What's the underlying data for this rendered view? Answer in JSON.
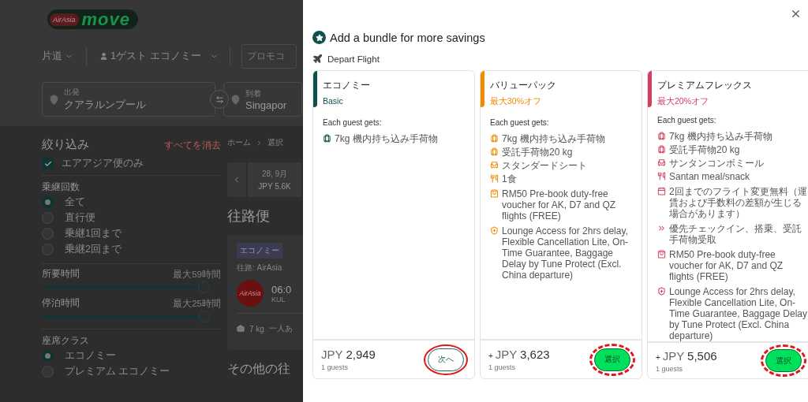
{
  "background_page": {
    "logo": {
      "badge": "AirAsia",
      "wordmark": "move"
    },
    "search_bar": {
      "trip_type": "片道",
      "guests": "1ゲスト エコノミー",
      "promo_placeholder": "プロモコ"
    },
    "origin": {
      "label": "出発",
      "value": "クアラルンプール"
    },
    "destination": {
      "label": "到着",
      "value": "Singapor"
    },
    "filters": {
      "title": "絞り込み",
      "clear": "すべてを消去",
      "airasia_only": {
        "label": "エアアジア便のみ",
        "checked": true
      },
      "stops": {
        "title": "乗継回数",
        "options": [
          {
            "label": "全て",
            "selected": true
          },
          {
            "label": "直行便",
            "selected": false
          },
          {
            "label": "乗継1回まで",
            "selected": false
          },
          {
            "label": "乗継2回まで",
            "selected": false
          }
        ]
      },
      "sliders": [
        {
          "title": "所要時間",
          "reading": "最大59時間",
          "level": 1
        },
        {
          "title": "停泊時間",
          "reading": "最大25時間",
          "level": 1
        }
      ],
      "cabin": {
        "title": "座席クラス",
        "options": [
          {
            "label": "エコノミー",
            "selected": true
          },
          {
            "label": "プレミアム エコノミー",
            "selected": false
          }
        ]
      }
    },
    "breadcrumb": [
      "ホーム",
      "選択"
    ],
    "date_strip": {
      "date": "28, 9月",
      "price": "JPY 5.6K"
    },
    "section_title": "往路便",
    "flight_card": {
      "tag": "エコノミー",
      "route": "往路: AirAsia",
      "airline_logo": "AirAsia",
      "time": "06:0",
      "airport": "KUL",
      "baggage": "7 kg",
      "note": "一人あ"
    },
    "more_title": "その他の往"
  },
  "drawer": {
    "title": "Add a bundle for more savings",
    "flight_label": "Depart Flight",
    "bundles": [
      {
        "name": "エコノミー",
        "subtitle": "Basic",
        "color": "#0f4f4f",
        "intro": "Each guest gets:",
        "features": [
          {
            "kind": "bag",
            "text": "7kg 機内持ち込み手荷物"
          }
        ],
        "currency": "JPY",
        "price": "2,949",
        "guests": "1 guests",
        "button": {
          "label": "次へ",
          "kind": "outline"
        },
        "ring": {
          "kind": "solid"
        }
      },
      {
        "name": "バリューパック",
        "subtitle": "最大30%オフ",
        "color": "#f08a00",
        "intro": "Each guest gets:",
        "features": [
          {
            "kind": "bag",
            "text": "7kg 機内持ち込み手荷物"
          },
          {
            "kind": "bag",
            "text": "受託手荷物20 kg"
          },
          {
            "kind": "seat",
            "text": "スタンダードシート"
          },
          {
            "kind": "meal",
            "text": "1食"
          }
        ],
        "perks": [
          {
            "kind": "voucher",
            "text": "RM50 Pre-book duty-free voucher for AK, D7 and QZ flights (FREE)"
          },
          {
            "kind": "shield",
            "text": "Lounge Access for 2hrs delay, Flexible Cancellation Lite, On-Time Guarantee, Baggage Delay by Tune Protect (Excl. China departure)"
          }
        ],
        "prefix": "+",
        "currency": "JPY",
        "price": "3,623",
        "guests": "1 guests",
        "button": {
          "label": "選択",
          "kind": "filled"
        },
        "ring": {
          "kind": "dashed"
        }
      },
      {
        "name": "プレミアムフレックス",
        "subtitle": "最大20%オフ",
        "color": "#d3405f",
        "intro": "Each guest gets:",
        "features": [
          {
            "kind": "bag",
            "text": "7kg 機内持ち込み手荷物"
          },
          {
            "kind": "bag",
            "text": "受託手荷物20 kg"
          },
          {
            "kind": "seat",
            "text": "サンタンコンボミール"
          },
          {
            "kind": "meal",
            "text": "Santan meal/snack"
          }
        ],
        "perks": [
          {
            "kind": "calendar",
            "text": "2回までのフライト変更無料（運賃および手数料の差額が生じる場合があります）"
          },
          {
            "kind": "priority",
            "text": "優先チェックイン、搭乗、受託手荷物受取"
          },
          {
            "kind": "voucher",
            "text": "RM50 Pre-book duty-free voucher for AK, D7 and QZ flights (FREE)"
          },
          {
            "kind": "shield",
            "text": "Lounge Access for 2hrs delay, Flexible Cancellation Lite, On-Time Guarantee, Baggage Delay by Tune Protect (Excl. China departure)"
          }
        ],
        "prefix": "+",
        "currency": "JPY",
        "price": "5,506",
        "guests": "1 guests",
        "button": {
          "label": "選択",
          "kind": "filled"
        },
        "ring": {
          "kind": "dashed"
        }
      }
    ]
  }
}
